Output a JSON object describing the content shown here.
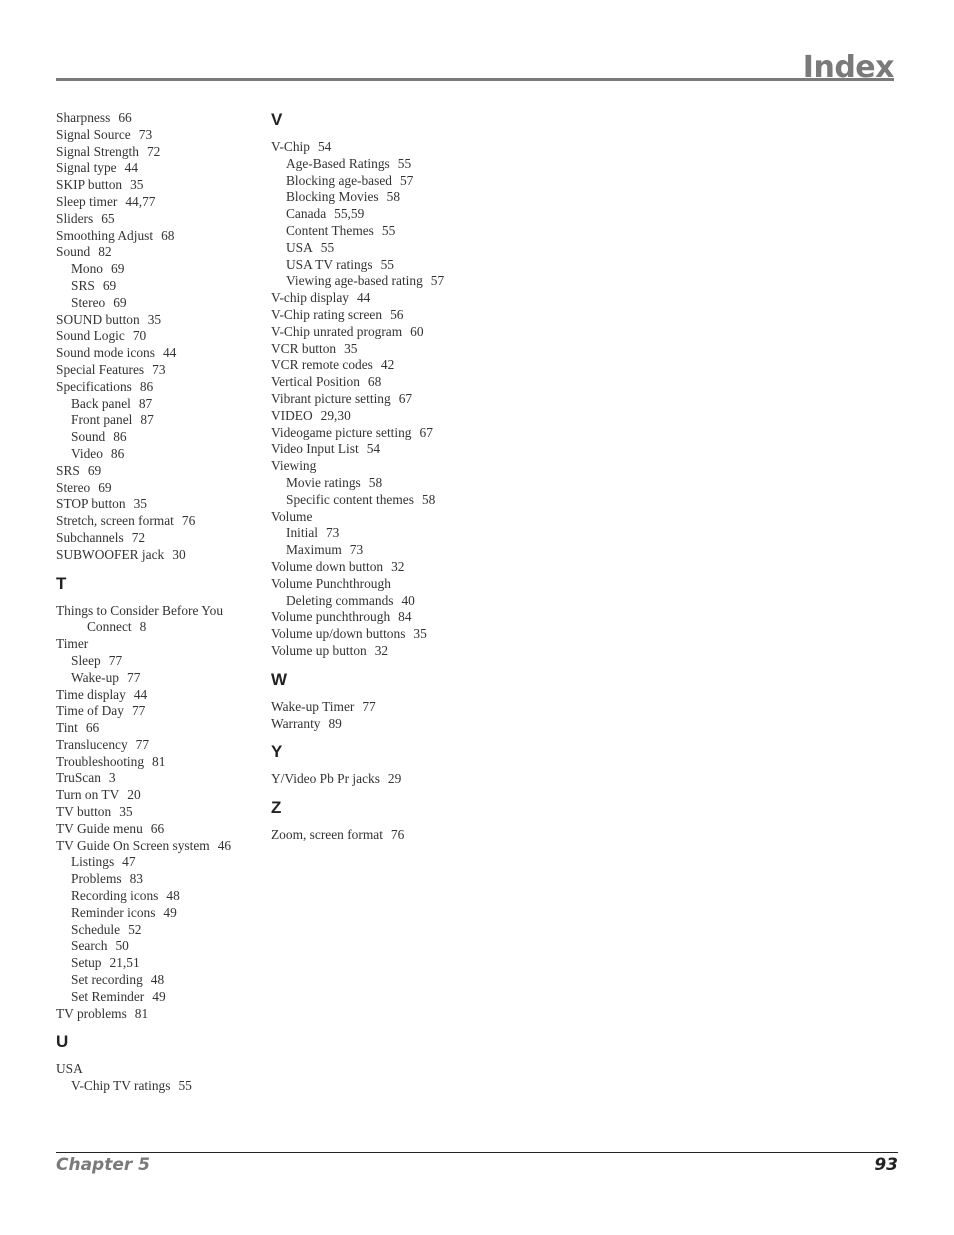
{
  "header": {
    "title": "Index"
  },
  "colors": {
    "header_gray": "#7a7a7a",
    "text": "#333333"
  },
  "left_column": [
    {
      "type": "entry",
      "term": "Sharpness",
      "pages": "66"
    },
    {
      "type": "entry",
      "term": "Signal Source",
      "pages": "73"
    },
    {
      "type": "entry",
      "term": "Signal Strength",
      "pages": "72"
    },
    {
      "type": "entry",
      "term": "Signal type",
      "pages": "44"
    },
    {
      "type": "entry",
      "term": "SKIP button",
      "pages": "35"
    },
    {
      "type": "entry",
      "term": "Sleep timer",
      "pages": "44,77"
    },
    {
      "type": "entry",
      "term": "Sliders",
      "pages": "65"
    },
    {
      "type": "entry",
      "term": "Smoothing Adjust",
      "pages": "68"
    },
    {
      "type": "entry",
      "term": "Sound",
      "pages": "82"
    },
    {
      "type": "sub",
      "term": "Mono",
      "pages": "69"
    },
    {
      "type": "sub",
      "term": "SRS",
      "pages": "69"
    },
    {
      "type": "sub",
      "term": "Stereo",
      "pages": "69"
    },
    {
      "type": "entry",
      "term": "SOUND button",
      "pages": "35"
    },
    {
      "type": "entry",
      "term": "Sound Logic",
      "pages": "70"
    },
    {
      "type": "entry",
      "term": "Sound mode icons",
      "pages": "44"
    },
    {
      "type": "entry",
      "term": "Special Features",
      "pages": "73"
    },
    {
      "type": "entry",
      "term": "Specifications",
      "pages": "86"
    },
    {
      "type": "sub",
      "term": "Back panel",
      "pages": "87"
    },
    {
      "type": "sub",
      "term": "Front panel",
      "pages": "87"
    },
    {
      "type": "sub",
      "term": "Sound",
      "pages": "86"
    },
    {
      "type": "sub",
      "term": "Video",
      "pages": "86"
    },
    {
      "type": "entry",
      "term": "SRS",
      "pages": "69"
    },
    {
      "type": "entry",
      "term": "Stereo",
      "pages": "69"
    },
    {
      "type": "entry",
      "term": "STOP button",
      "pages": "35"
    },
    {
      "type": "entry",
      "term": "Stretch, screen format",
      "pages": "76"
    },
    {
      "type": "entry",
      "term": "Subchannels",
      "pages": "72"
    },
    {
      "type": "entry",
      "term": "SUBWOOFER jack",
      "pages": "30"
    },
    {
      "type": "letter",
      "term": "T"
    },
    {
      "type": "entry",
      "term": "Things to Consider Before You",
      "pages": ""
    },
    {
      "type": "cont",
      "term": "Connect",
      "pages": "8"
    },
    {
      "type": "entry",
      "term": "Timer",
      "pages": ""
    },
    {
      "type": "sub",
      "term": "Sleep",
      "pages": "77"
    },
    {
      "type": "sub",
      "term": "Wake-up",
      "pages": "77"
    },
    {
      "type": "entry",
      "term": "Time display",
      "pages": "44"
    },
    {
      "type": "entry",
      "term": "Time of Day",
      "pages": "77"
    },
    {
      "type": "entry",
      "term": "Tint",
      "pages": "66"
    },
    {
      "type": "entry",
      "term": "Translucency",
      "pages": "77"
    },
    {
      "type": "entry",
      "term": "Troubleshooting",
      "pages": "81"
    },
    {
      "type": "entry",
      "term": "TruScan",
      "pages": "3"
    },
    {
      "type": "entry",
      "term": "Turn on TV",
      "pages": "20"
    },
    {
      "type": "entry",
      "term": "TV button",
      "pages": "35"
    },
    {
      "type": "entry",
      "term": "TV Guide menu",
      "pages": "66"
    },
    {
      "type": "entry",
      "term": "TV Guide On Screen system",
      "pages": "46"
    },
    {
      "type": "sub",
      "term": "Listings",
      "pages": "47"
    },
    {
      "type": "sub",
      "term": "Problems",
      "pages": "83"
    },
    {
      "type": "sub",
      "term": "Recording icons",
      "pages": "48"
    },
    {
      "type": "sub",
      "term": "Reminder icons",
      "pages": "49"
    },
    {
      "type": "sub",
      "term": "Schedule",
      "pages": "52"
    },
    {
      "type": "sub",
      "term": "Search",
      "pages": "50"
    },
    {
      "type": "sub",
      "term": "Setup",
      "pages": "21,51"
    },
    {
      "type": "sub",
      "term": "Set recording",
      "pages": "48"
    },
    {
      "type": "sub",
      "term": "Set Reminder",
      "pages": "49"
    },
    {
      "type": "entry",
      "term": "TV problems",
      "pages": "81"
    },
    {
      "type": "letter",
      "term": "U"
    },
    {
      "type": "entry",
      "term": "USA",
      "pages": ""
    },
    {
      "type": "sub",
      "term": "V-Chip TV ratings",
      "pages": "55"
    }
  ],
  "right_column": [
    {
      "type": "letter",
      "term": "V"
    },
    {
      "type": "entry",
      "term": "V-Chip",
      "pages": "54"
    },
    {
      "type": "sub",
      "term": "Age-Based Ratings",
      "pages": "55"
    },
    {
      "type": "sub",
      "term": "Blocking age-based",
      "pages": "57"
    },
    {
      "type": "sub",
      "term": "Blocking Movies",
      "pages": "58"
    },
    {
      "type": "sub",
      "term": "Canada",
      "pages": "55,59"
    },
    {
      "type": "sub",
      "term": "Content Themes",
      "pages": "55"
    },
    {
      "type": "sub",
      "term": "USA",
      "pages": "55"
    },
    {
      "type": "sub",
      "term": "USA TV ratings",
      "pages": "55"
    },
    {
      "type": "sub",
      "term": "Viewing age-based rating",
      "pages": "57"
    },
    {
      "type": "entry",
      "term": "V-chip display",
      "pages": "44"
    },
    {
      "type": "entry",
      "term": "V-Chip rating screen",
      "pages": "56"
    },
    {
      "type": "entry",
      "term": "V-Chip unrated program",
      "pages": "60"
    },
    {
      "type": "entry",
      "term": "VCR button",
      "pages": "35"
    },
    {
      "type": "entry",
      "term": "VCR remote codes",
      "pages": "42"
    },
    {
      "type": "entry",
      "term": "Vertical Position",
      "pages": "68"
    },
    {
      "type": "entry",
      "term": "Vibrant picture setting",
      "pages": "67"
    },
    {
      "type": "entry",
      "term": "VIDEO",
      "pages": "29,30"
    },
    {
      "type": "entry",
      "term": "Videogame picture setting",
      "pages": "67"
    },
    {
      "type": "entry",
      "term": "Video Input List",
      "pages": "54"
    },
    {
      "type": "entry",
      "term": "Viewing",
      "pages": ""
    },
    {
      "type": "sub",
      "term": "Movie ratings",
      "pages": "58"
    },
    {
      "type": "sub",
      "term": "Specific content themes",
      "pages": "58"
    },
    {
      "type": "entry",
      "term": "Volume",
      "pages": ""
    },
    {
      "type": "sub",
      "term": "Initial",
      "pages": "73"
    },
    {
      "type": "sub",
      "term": "Maximum",
      "pages": "73"
    },
    {
      "type": "entry",
      "term": "Volume down button",
      "pages": "32"
    },
    {
      "type": "entry",
      "term": "Volume Punchthrough",
      "pages": ""
    },
    {
      "type": "sub",
      "term": "Deleting commands",
      "pages": "40"
    },
    {
      "type": "entry",
      "term": "Volume punchthrough",
      "pages": "84"
    },
    {
      "type": "entry",
      "term": "Volume up/down buttons",
      "pages": "35"
    },
    {
      "type": "entry",
      "term": "Volume up button",
      "pages": "32"
    },
    {
      "type": "letter",
      "term": "W"
    },
    {
      "type": "entry",
      "term": "Wake-up Timer",
      "pages": "77"
    },
    {
      "type": "entry",
      "term": "Warranty",
      "pages": "89"
    },
    {
      "type": "letter",
      "term": "Y"
    },
    {
      "type": "entry",
      "term": "Y/Video Pb Pr jacks",
      "pages": "29"
    },
    {
      "type": "letter",
      "term": "Z"
    },
    {
      "type": "entry",
      "term": "Zoom, screen format",
      "pages": "76"
    }
  ],
  "footer": {
    "chapter": "Chapter 5",
    "page_number": "93"
  }
}
